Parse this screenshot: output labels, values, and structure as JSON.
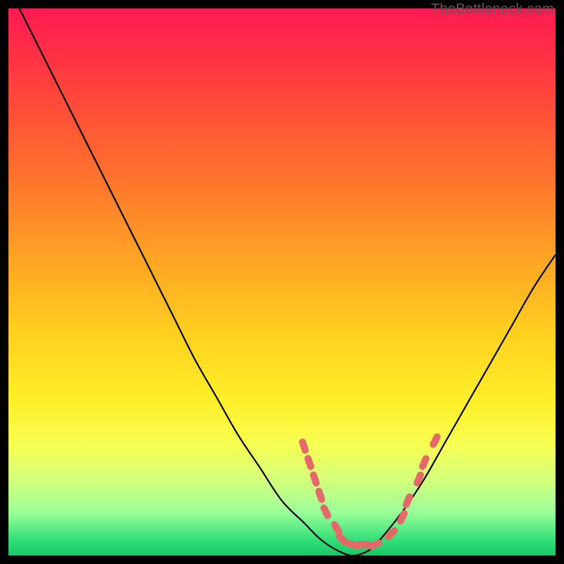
{
  "watermark": "TheBottleneck.com",
  "colors": {
    "page_bg": "#000000",
    "gradient_top": "#ff1a52",
    "gradient_mid": "#ffd21f",
    "gradient_bottom": "#17c765",
    "curve": "#000000",
    "marker": "#e46a6a"
  },
  "chart_data": {
    "type": "line",
    "title": "",
    "xlabel": "",
    "ylabel": "",
    "xlim": [
      0,
      100
    ],
    "ylim": [
      0,
      100
    ],
    "series": [
      {
        "name": "bottleneck-curve",
        "x": [
          2,
          6,
          10,
          14,
          18,
          22,
          26,
          30,
          34,
          38,
          42,
          46,
          50,
          54,
          57,
          60,
          63,
          66,
          68,
          72,
          76,
          80,
          84,
          88,
          92,
          96,
          100
        ],
        "y": [
          100,
          92,
          84,
          76,
          68,
          60,
          52,
          44,
          36,
          29,
          22,
          16,
          10,
          6,
          3,
          1,
          0,
          1,
          3,
          8,
          14,
          21,
          28,
          35,
          42,
          49,
          55
        ]
      }
    ],
    "markers": {
      "name": "highlight-dashes",
      "points": [
        {
          "x": 54,
          "y": 20
        },
        {
          "x": 55,
          "y": 17
        },
        {
          "x": 56,
          "y": 14
        },
        {
          "x": 57,
          "y": 11
        },
        {
          "x": 58,
          "y": 8
        },
        {
          "x": 60,
          "y": 5
        },
        {
          "x": 61,
          "y": 3
        },
        {
          "x": 63,
          "y": 2
        },
        {
          "x": 65,
          "y": 2
        },
        {
          "x": 67,
          "y": 2
        },
        {
          "x": 70,
          "y": 4
        },
        {
          "x": 72,
          "y": 7
        },
        {
          "x": 73,
          "y": 10
        },
        {
          "x": 75,
          "y": 14
        },
        {
          "x": 76,
          "y": 17
        },
        {
          "x": 78,
          "y": 21
        }
      ]
    }
  }
}
